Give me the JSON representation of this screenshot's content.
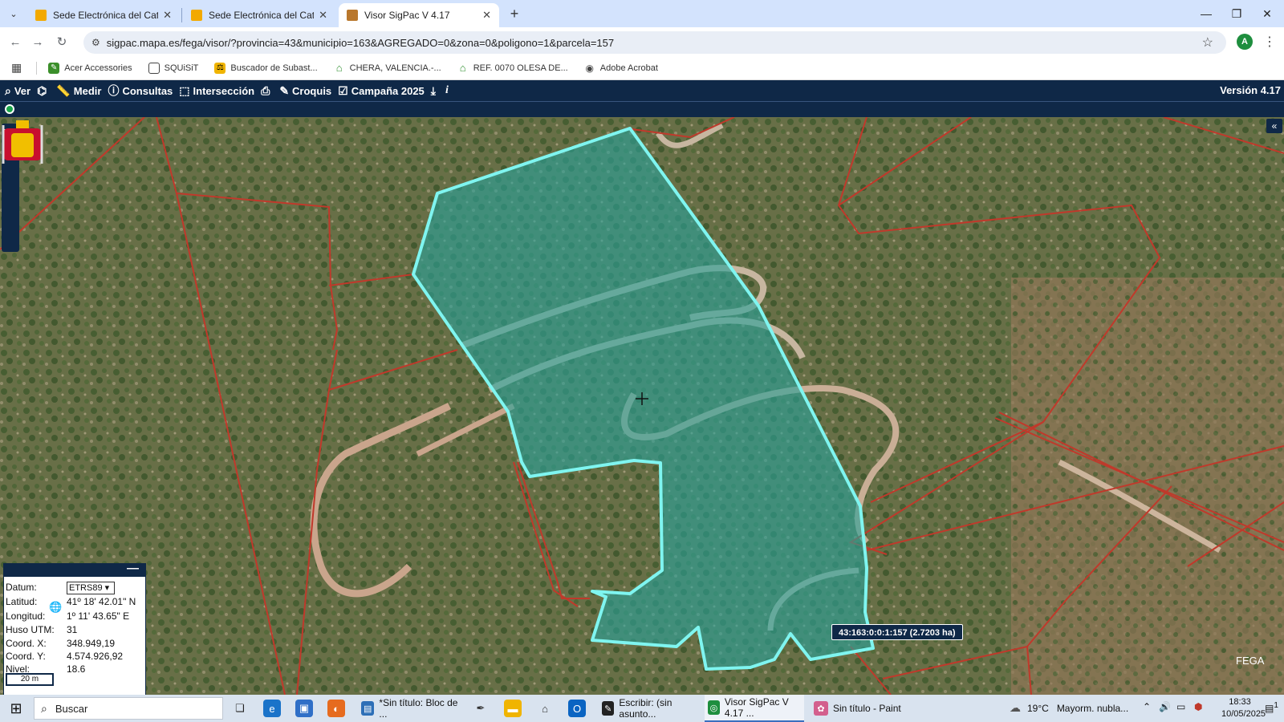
{
  "browser": {
    "tabs": [
      {
        "title": "Sede Electrónica del Catastro -",
        "active": false
      },
      {
        "title": "Sede Electrónica del Catastro",
        "active": false
      },
      {
        "title": "Visor SigPac V 4.17",
        "active": true
      }
    ],
    "new_tab": "+",
    "url": "sigpac.mapa.es/fega/visor/?provincia=43&municipio=163&AGREGADO=0&zona=0&poligono=1&parcela=157",
    "profile_initial": "A"
  },
  "bookmarks": [
    {
      "label": "Acer Accessories",
      "icon": "acer-icon",
      "color": "#3b8f2a"
    },
    {
      "label": "SQUiSiT",
      "icon": "folder-icon",
      "color": "#444444"
    },
    {
      "label": "Buscador de Subast...",
      "icon": "auction-icon",
      "color": "#f0b400"
    },
    {
      "label": "CHERA, VALENCIA.-...",
      "icon": "house-icon",
      "color": "#2f8f2f"
    },
    {
      "label": "REF. 0070 OLESA DE...",
      "icon": "house-icon",
      "color": "#2f8f2f"
    },
    {
      "label": "Adobe Acrobat",
      "icon": "acrobat-icon",
      "color": "#444444"
    }
  ],
  "toolbar": {
    "items": [
      {
        "label": "Ver",
        "icon": "search-icon"
      },
      {
        "label": "",
        "icon": "binoculars-icon"
      },
      {
        "label": "Medir",
        "icon": "ruler-icon"
      },
      {
        "label": "Consultas",
        "icon": "info-icon"
      },
      {
        "label": "Intersección",
        "icon": "intersection-icon"
      },
      {
        "label": "",
        "icon": "printer-icon"
      },
      {
        "label": "Croquis",
        "icon": "pencil-icon"
      },
      {
        "label": "Campaña 2025",
        "icon": "calendar-check-icon"
      },
      {
        "label": "",
        "icon": "download-icon"
      },
      {
        "label": "",
        "icon": "info-italic-icon"
      }
    ],
    "version": "Versión 4.17"
  },
  "map": {
    "zoom_level": "18.6",
    "parcel_label": "43:163:0:0:1:157 (2.7203 ha)",
    "brand": "FEGA",
    "colors": {
      "parcel_fill": "#2aa29a",
      "parcel_stroke": "#7ff5f0",
      "boundary": "#c0392b"
    }
  },
  "coords": {
    "datum_label": "Datum:",
    "datum_value": "ETRS89",
    "lat_label": "Latitud:",
    "lat_value": "41º 18' 42.01\" N",
    "lon_label": "Longitud:",
    "lon_value": "1º 11' 43.65\" E",
    "huso_label": "Huso UTM:",
    "huso_value": "31",
    "x_label": "Coord. X:",
    "x_value": "348.949,19",
    "y_label": "Coord. Y:",
    "y_value": "4.574.926,92",
    "nivel_label": "Nivel:",
    "nivel_value": "18.6",
    "scale": "20 m"
  },
  "taskbar": {
    "search_placeholder": "Buscar",
    "apps": [
      {
        "label": "*Sin título: Bloc de ...",
        "icon": "notepad-icon",
        "color": "#2d6fb7"
      },
      {
        "label": "Escribir: (sin asunto...",
        "icon": "pen-icon",
        "color": "#222222"
      },
      {
        "label": "Visor SigPac V 4.17 ...",
        "icon": "chrome-icon",
        "color": "#1e8e3e"
      },
      {
        "label": "Sin título - Paint",
        "icon": "paint-icon",
        "color": "#d35f8d"
      }
    ],
    "weather_temp": "19°C",
    "weather_text": "Mayorm. nubla...",
    "time": "18:33",
    "date": "10/05/2025",
    "notifications": "1"
  }
}
